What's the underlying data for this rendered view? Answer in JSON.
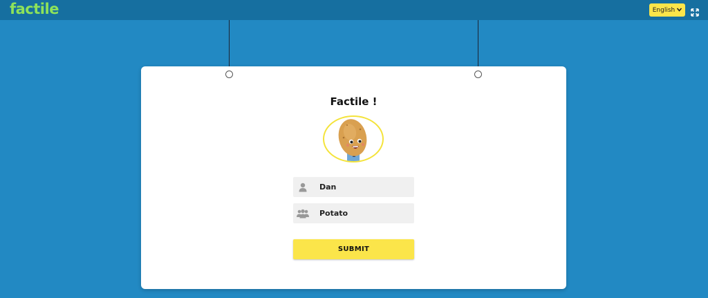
{
  "header": {
    "logo": "factile",
    "language_label": "English",
    "language_icon": "chevron-down-icon",
    "fullscreen_icon": "expand-icon"
  },
  "card": {
    "title": "Factile !",
    "avatar_icon": "potato-character-avatar",
    "name_field": {
      "value": "Dan",
      "icon": "user-icon"
    },
    "team_field": {
      "value": "Potato",
      "icon": "team-icon"
    },
    "submit_label": "SUBMIT"
  },
  "colors": {
    "background": "#2289c3",
    "topbar": "#166fa0",
    "logo": "#8ee35a",
    "accent_yellow": "#fbe54a"
  }
}
